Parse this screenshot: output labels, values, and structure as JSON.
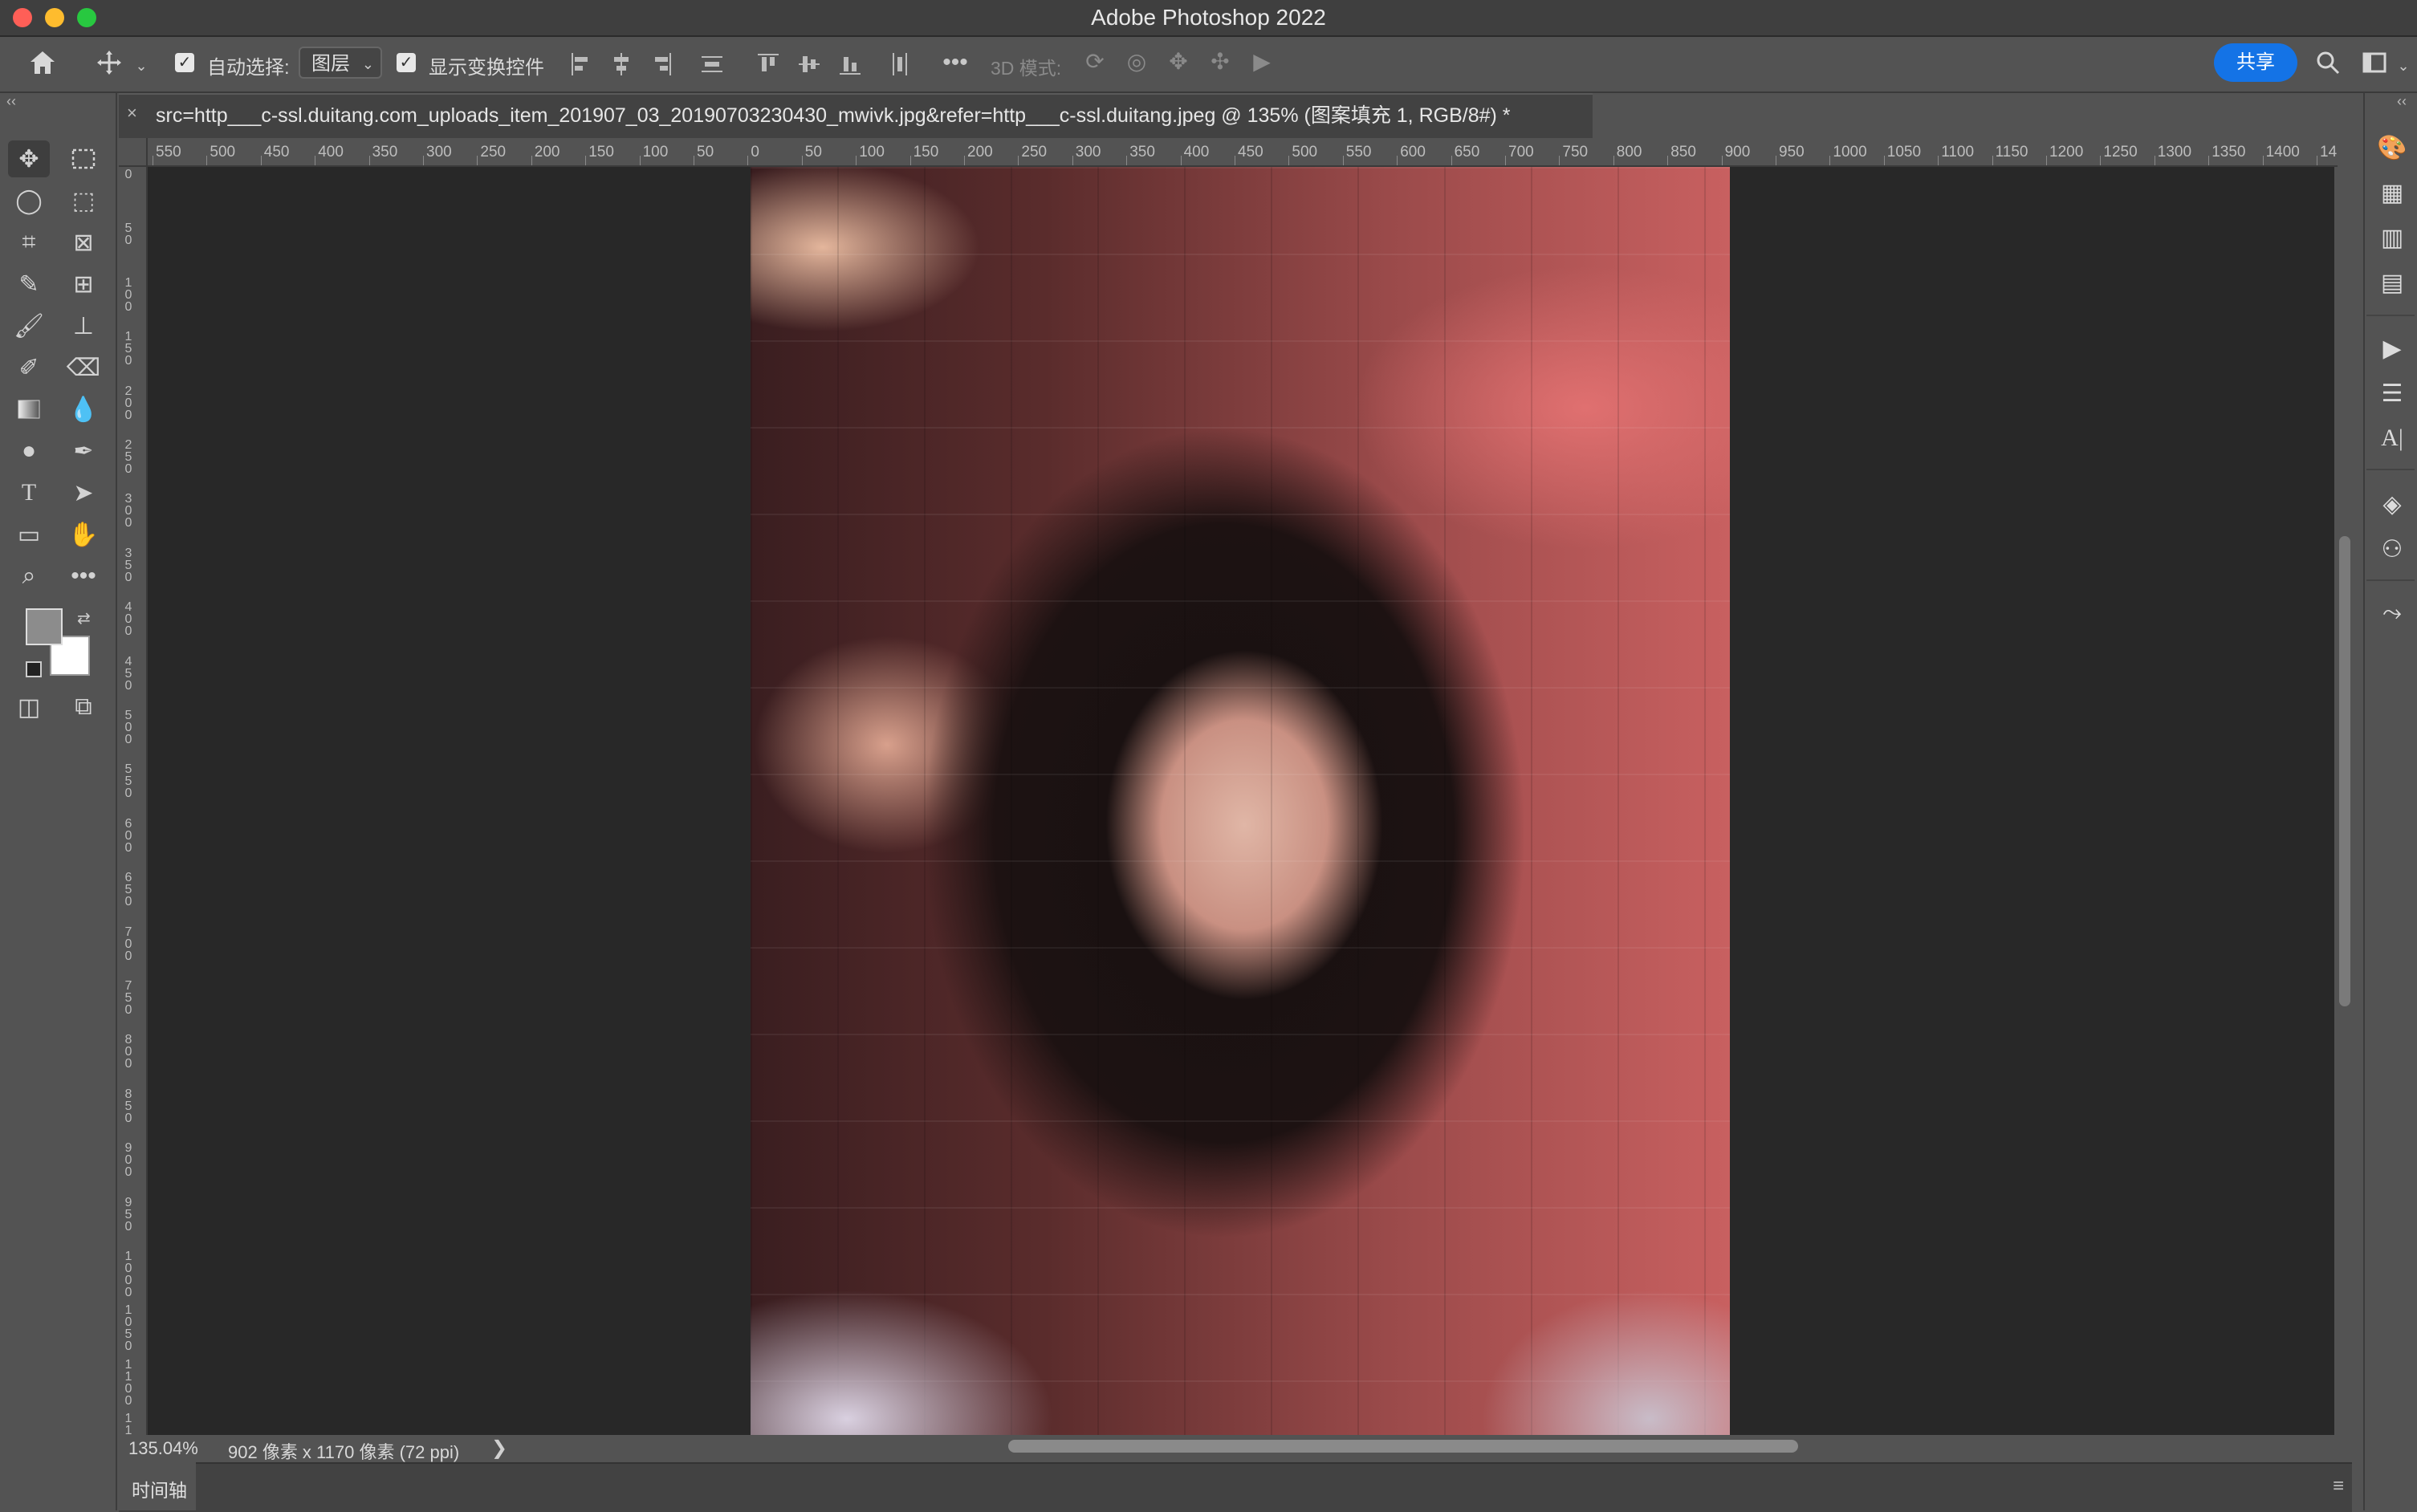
{
  "window": {
    "title": "Adobe Photoshop 2022"
  },
  "options_bar": {
    "auto_select_label": "自动选择:",
    "auto_select_target": "图层",
    "show_transform_label": "显示变换控件",
    "mode_3d_label": "3D 模式:",
    "share_label": "共享"
  },
  "document": {
    "tab_title": "src=http___c-ssl.duitang.com_uploads_item_201907_03_20190703230430_mwivk.jpg&refer=http___c-ssl.duitang.jpeg @ 135% (图案填充 1, RGB/8#) *",
    "close_glyph": "×"
  },
  "ruler": {
    "horizontal_labels": [
      "550",
      "500",
      "450",
      "400",
      "350",
      "300",
      "250",
      "200",
      "150",
      "100",
      "50",
      "0",
      "50",
      "100",
      "150",
      "200",
      "250",
      "300",
      "350",
      "400",
      "450",
      "500",
      "550",
      "600",
      "650",
      "700",
      "750",
      "800",
      "850",
      "900",
      "950",
      "1000",
      "1050",
      "1100",
      "1150",
      "1200",
      "1250",
      "1300",
      "1350",
      "1400",
      "14"
    ],
    "vertical_labels": [
      "0",
      "5 0",
      "1 0 0",
      "1 5 0",
      "2 0 0",
      "2 5 0",
      "3 0 0",
      "3 5 0",
      "4 0 0",
      "4 5 0",
      "5 0 0",
      "5 5 0",
      "6 0 0",
      "6 5 0",
      "7 0 0",
      "7 5 0",
      "8 0 0",
      "8 5 0",
      "9 0 0",
      "9 5 0",
      "1 0 0 0",
      "1 0 5 0",
      "1 1 0 0",
      "1 1"
    ]
  },
  "status_bar": {
    "zoom": "135.04%",
    "doc_info": "902 像素 x 1170 像素 (72 ppi)",
    "arrow": "❯"
  },
  "timeline": {
    "label": "时间轴"
  },
  "colors": {
    "accent": "#1473e6",
    "canvas_bg": "#282828",
    "ui_bg": "#535353"
  }
}
